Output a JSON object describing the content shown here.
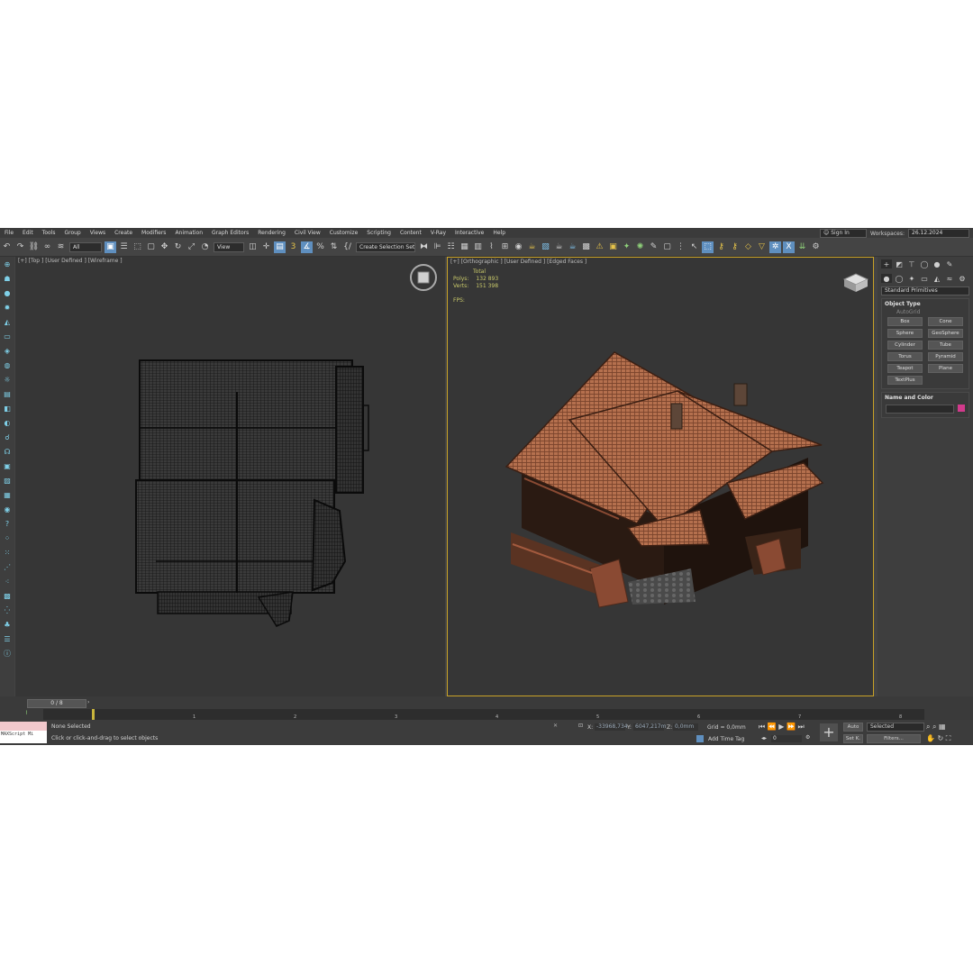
{
  "menu": [
    "File",
    "Edit",
    "Tools",
    "Group",
    "Views",
    "Create",
    "Modifiers",
    "Animation",
    "Graph Editors",
    "Rendering",
    "Civil View",
    "Customize",
    "Scripting",
    "Content",
    "V-Ray",
    "Interactive",
    "Help"
  ],
  "account": {
    "sign_in": "Sign In",
    "workspaces_label": "Workspaces:",
    "workspace_value": "26.12.2024"
  },
  "toolbar": {
    "filter_all": "All",
    "ref_coord": "View",
    "selection_set": "Create Selection Set"
  },
  "viewports": {
    "top": {
      "label": "[+] [Top ] [User Defined ] [Wireframe ]"
    },
    "ortho": {
      "label": "[+] [Orthographic ] [User Defined ] [Edged Faces ]",
      "stats": {
        "total_label": "Total",
        "polys_label": "Polys:",
        "polys": "132 893",
        "verts_label": "Verts:",
        "verts": "151 398",
        "fps_label": "FPS:"
      }
    }
  },
  "command_panel": {
    "dropdown": "Standard Primitives",
    "object_type": {
      "title": "Object Type",
      "autogrid": "AutoGrid",
      "buttons": [
        "Box",
        "Cone",
        "Sphere",
        "GeoSphere",
        "Cylinder",
        "Tube",
        "Torus",
        "Pyramid",
        "Teapot",
        "Plane",
        "TextPlus"
      ]
    },
    "name_color": {
      "title": "Name and Color",
      "swatch_color": "#d23a8c"
    }
  },
  "timeline": {
    "frame": "0 / 8",
    "ticks": [
      "1",
      "2",
      "3",
      "4",
      "5",
      "6",
      "7",
      "8"
    ]
  },
  "status": {
    "maxscript": "MAXScript Mi",
    "selection": "None Selected",
    "prompt": "Click or click-and-drag to select objects",
    "x_label": "X:",
    "x": "-33968,734",
    "y_label": "Y:",
    "y": "6047,217m",
    "z_label": "Z:",
    "z": "0,0mm",
    "grid": "Grid = 0,0mm",
    "add_time_tag": "Add Time Tag",
    "auto": "Auto",
    "selected": "Selected",
    "set_k": "Set K.",
    "filters": "Filters...",
    "frame_field": "0"
  }
}
